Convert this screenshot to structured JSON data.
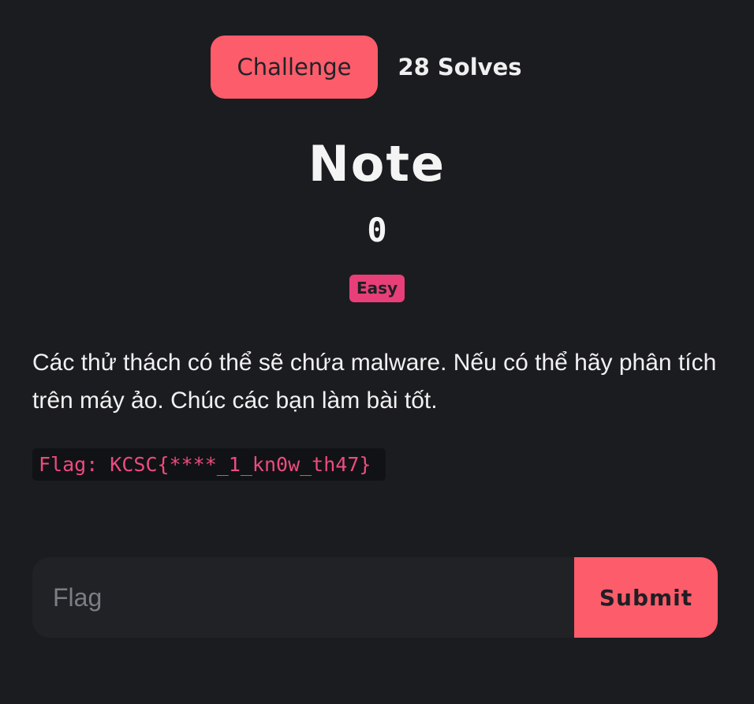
{
  "tabs": {
    "challenge_label": "Challenge",
    "solves_label": "28 Solves"
  },
  "challenge": {
    "name": "Note",
    "points": "0",
    "difficulty": "Easy",
    "description": "Các thử thách có thể sẽ chứa malware. Nếu có thể hãy phân tích trên máy ảo. Chúc các bạn làm bài tốt.",
    "flag_format": "Flag: KCSC{****_1_kn0w_th47}"
  },
  "form": {
    "flag_placeholder": "Flag",
    "flag_value": "",
    "submit_label": "Submit"
  },
  "colors": {
    "background": "#1b1c20",
    "accent": "#fd5c6b",
    "badge_easy": "#e83f78",
    "code_text": "#ec4c7e"
  }
}
